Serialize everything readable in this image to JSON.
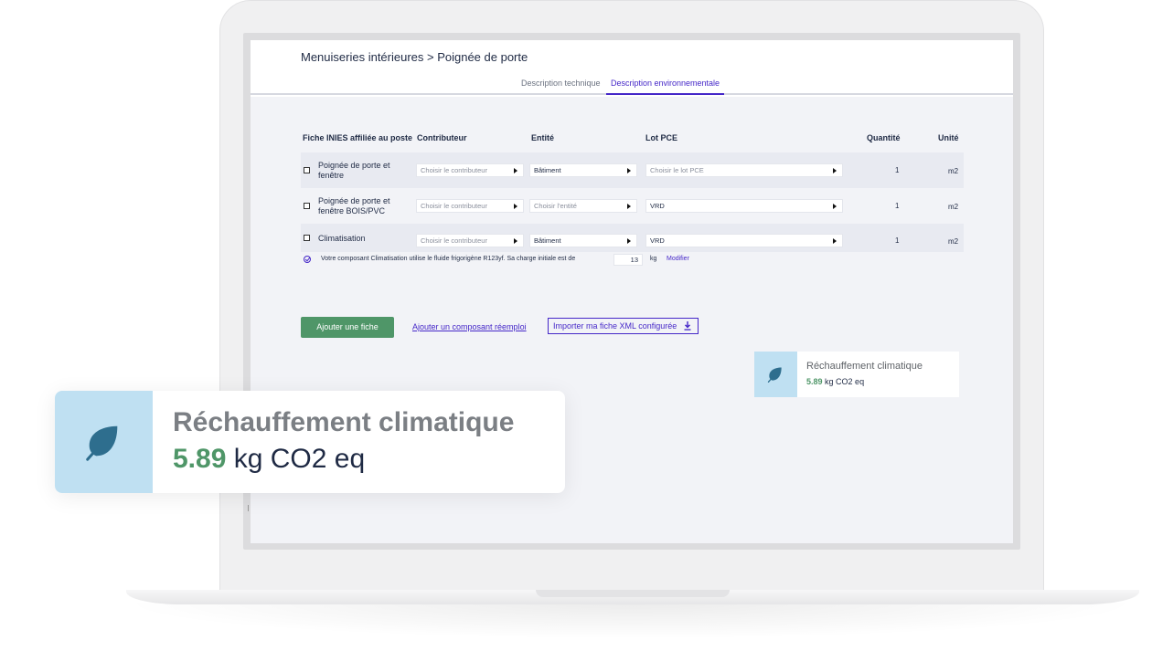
{
  "header": {
    "breadcrumb": "Menuiseries intérieures > Poignée de porte",
    "tabs": [
      {
        "label": "Description technique",
        "active": false
      },
      {
        "label": "Description environnementale",
        "active": true
      }
    ]
  },
  "table": {
    "columns": [
      "Fiche INIES affiliée au poste",
      "Contributeur",
      "Entité",
      "Lot PCE",
      "Quantité",
      "Unité"
    ],
    "rows": [
      {
        "name": "Poignée de porte et fenêtre",
        "contributor": "Choisir le contributeur",
        "entity": "Bâtiment",
        "lot": "Choisir le lot PCE",
        "quantity": "1",
        "unit": "m2"
      },
      {
        "name": "Poignée de porte et fenêtre BOIS/PVC",
        "contributor": "Choisir le contributeur",
        "entity": "Choisir l'entité",
        "lot": "VRD",
        "quantity": "1",
        "unit": "m2"
      },
      {
        "name": "Climatisation",
        "contributor": "Choisir le contributeur",
        "entity": "Bâtiment",
        "lot": "VRD",
        "quantity": "1",
        "unit": "m2"
      }
    ],
    "info": {
      "text": "Votre composant Climatisation utilise le fluide frigorigène R123yf. Sa charge initiale est de",
      "charge_value": "13",
      "charge_unit": "kg",
      "modify_label": "Modifier"
    }
  },
  "actions": {
    "add_label": "Ajouter une fiche",
    "reuse_label": "Ajouter un composant réemploi",
    "import_label": "Importer ma fiche XML configurée"
  },
  "impact": {
    "title": "Réchauffement climatique",
    "value": "5.89",
    "unit": "kg CO2 eq"
  },
  "colors": {
    "accent": "#4527c8",
    "green": "#4f9668",
    "leaf": "#2e6e8e",
    "icon_bg": "#bfe0f2"
  },
  "icons": {
    "leaf": "leaf-icon",
    "download": "download-icon",
    "info": "check-circle-icon"
  }
}
